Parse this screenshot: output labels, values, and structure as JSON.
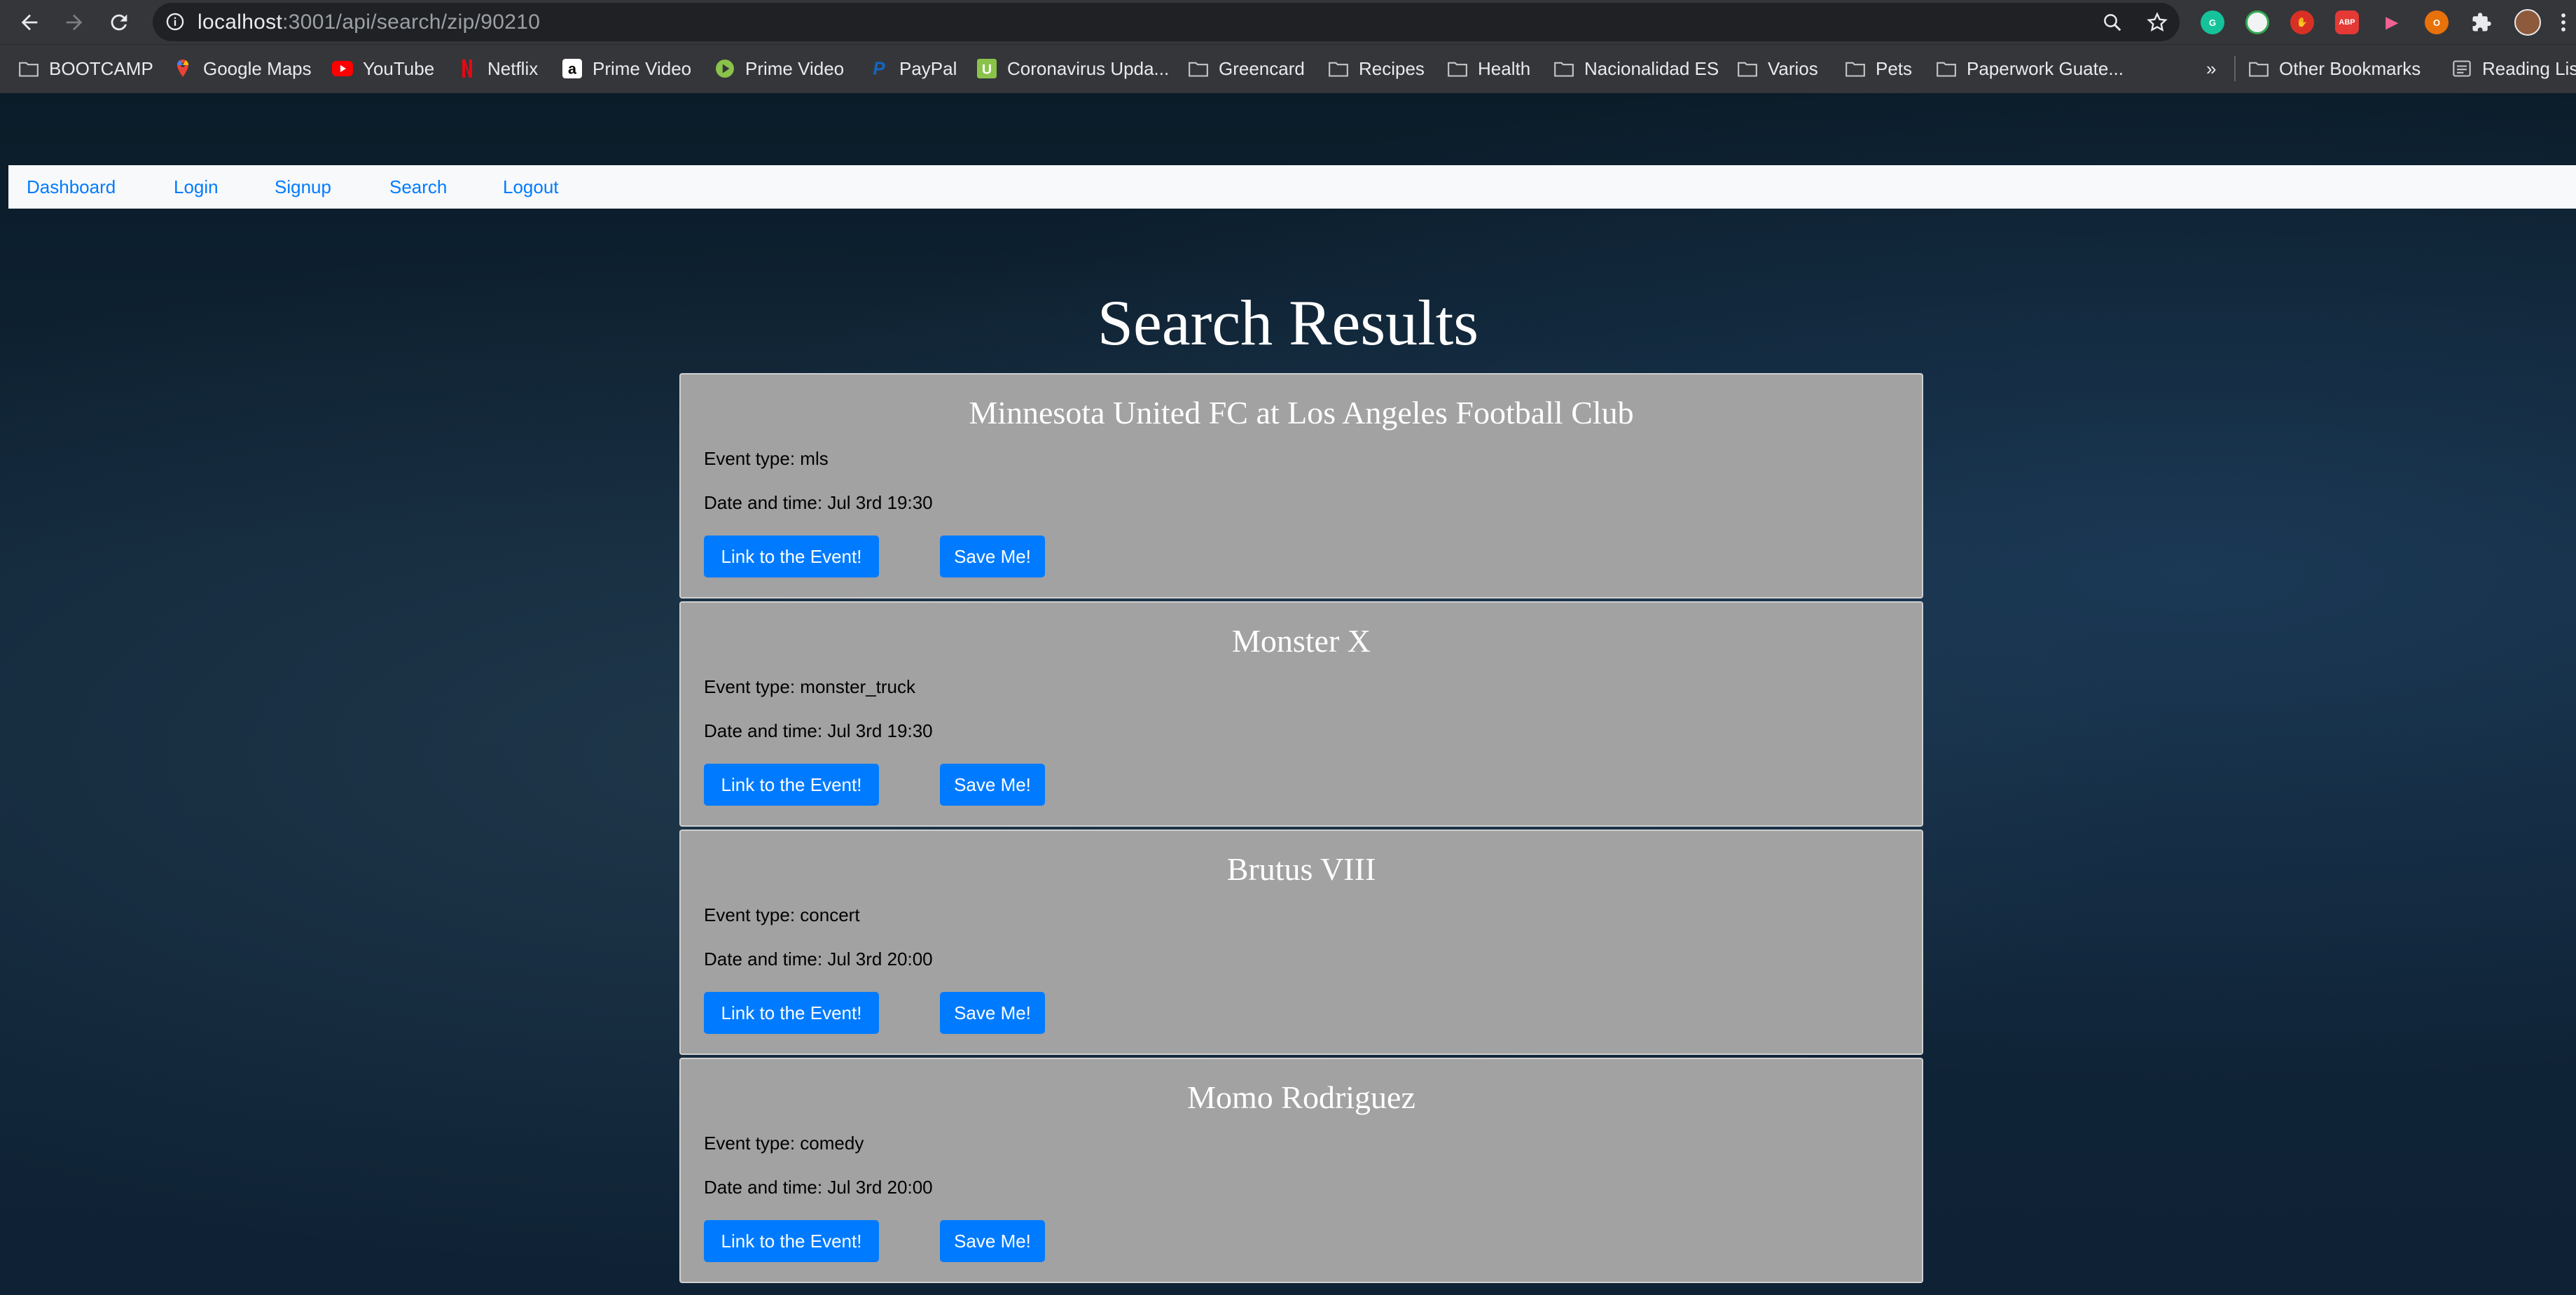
{
  "browser": {
    "url_host": "localhost",
    "url_rest": ":3001/api/search/zip/90210",
    "bookmarks": [
      {
        "label": "BOOTCAMP",
        "icon": "folder-icon"
      },
      {
        "label": "Google Maps",
        "icon": "google-maps-icon"
      },
      {
        "label": "YouTube",
        "icon": "youtube-icon"
      },
      {
        "label": "Netflix",
        "icon": "netflix-icon"
      },
      {
        "label": "Prime Video",
        "icon": "amazon-icon"
      },
      {
        "label": "Prime Video",
        "icon": "prime-video-icon"
      },
      {
        "label": "PayPal",
        "icon": "paypal-icon"
      },
      {
        "label": "Coronavirus Upda...",
        "icon": "coronavirus-site-icon"
      },
      {
        "label": "Greencard",
        "icon": "folder-icon"
      },
      {
        "label": "Recipes",
        "icon": "folder-icon"
      },
      {
        "label": "Health",
        "icon": "folder-icon"
      },
      {
        "label": "Nacionalidad ES",
        "icon": "folder-icon"
      },
      {
        "label": "Varios",
        "icon": "folder-icon"
      },
      {
        "label": "Pets",
        "icon": "folder-icon"
      },
      {
        "label": "Paperwork Guate...",
        "icon": "folder-icon"
      }
    ],
    "overflow_label": "»",
    "other_bookmarks": "Other Bookmarks",
    "reading_list": "Reading Lis"
  },
  "nav": {
    "dashboard": "Dashboard",
    "login": "Login",
    "signup": "Signup",
    "search": "Search",
    "logout": "Logout"
  },
  "page_title": "Search Results",
  "results": [
    {
      "title": "Minnesota United FC at Los Angeles Football Club",
      "type": "Event type: mls",
      "datetime": "Date and time: Jul 3rd 19:30",
      "link_label": "Link to the Event!",
      "save_label": "Save Me!"
    },
    {
      "title": "Monster X",
      "type": "Event type: monster_truck",
      "datetime": "Date and time: Jul 3rd 19:30",
      "link_label": "Link to the Event!",
      "save_label": "Save Me!"
    },
    {
      "title": "Brutus VIII",
      "type": "Event type: concert",
      "datetime": "Date and time: Jul 3rd 20:00",
      "link_label": "Link to the Event!",
      "save_label": "Save Me!"
    },
    {
      "title": "Momo Rodriguez",
      "type": "Event type: comedy",
      "datetime": "Date and time: Jul 3rd 20:00",
      "link_label": "Link to the Event!",
      "save_label": "Save Me!"
    }
  ],
  "colors": {
    "nav_link": "#007bff",
    "button": "#007bff",
    "card": "#a2a2a2",
    "navbar": "#f8f9fa"
  }
}
